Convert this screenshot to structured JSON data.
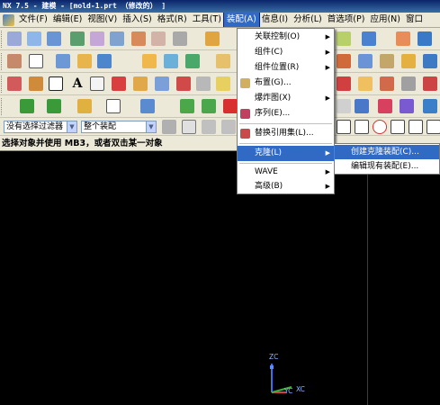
{
  "window": {
    "title": "NX 7.5 - 建模 - [mold-1.prt （修改的）  ]"
  },
  "menubar": {
    "items": [
      "文件(F)",
      "编辑(E)",
      "视图(V)",
      "插入(S)",
      "格式(R)",
      "工具(T)",
      "装配(A)",
      "信息(I)",
      "分析(L)",
      "首选项(P)",
      "应用(N)",
      "窗口"
    ],
    "active": "装配(A)"
  },
  "filterbar": {
    "filter_value": "没有选择过滤器",
    "scope_value": "整个装配"
  },
  "status": {
    "prompt": "选择对象并使用 MB3，或者双击某一对象"
  },
  "assembly_menu": {
    "items": [
      {
        "label": "关联控制(O)",
        "submenu": true
      },
      {
        "label": "组件(C)",
        "submenu": true
      },
      {
        "label": "组件位置(R)",
        "submenu": true
      },
      {
        "label": "布置(G)...",
        "submenu": false
      },
      {
        "label": "爆炸图(X)",
        "submenu": true
      },
      {
        "label": "序列(E)...",
        "submenu": false
      },
      {
        "label": "替换引用集(L)...",
        "submenu": false
      },
      {
        "label": "克隆(L)",
        "submenu": true
      },
      {
        "label": "WAVE",
        "submenu": true
      },
      {
        "label": "高级(B)",
        "submenu": true
      }
    ]
  },
  "clone_submenu": {
    "items": [
      "创建克隆装配(C)...",
      "编辑现有装配(E)..."
    ]
  },
  "triad": {
    "z_label": "ZC",
    "y_label": "YC",
    "x_label": "XC"
  },
  "colors": {
    "highlight": "#316ac5",
    "menubar_bg": "#ece9d8",
    "graphics_bg": "#000000"
  }
}
